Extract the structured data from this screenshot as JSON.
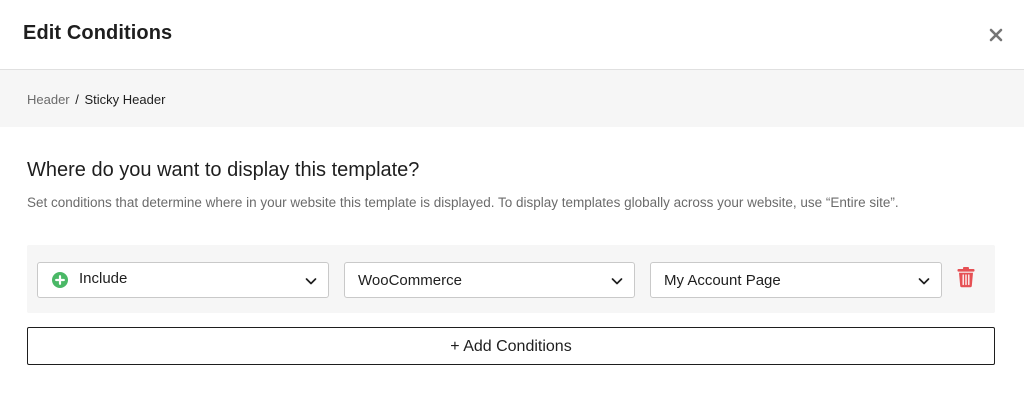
{
  "modal": {
    "title": "Edit Conditions"
  },
  "breadcrumb": {
    "parent": "Header",
    "separator": "/",
    "current": "Sticky Header"
  },
  "section": {
    "title": "Where do you want to display this template?",
    "description": "Set conditions that determine where in your website this template is displayed. To display templates globally across your website, use “Entire site”."
  },
  "condition": {
    "type": "Include",
    "group": "WooCommerce",
    "page": "My Account Page"
  },
  "add_button": {
    "label": "+ Add Conditions"
  },
  "colors": {
    "include_icon": "#4ab866",
    "trash_icon": "#e65054",
    "panel_bg": "#f6f6f6"
  },
  "icons": {
    "close": "close-icon",
    "include": "plus-circle-icon",
    "dropdown": "chevron-down-icon",
    "delete": "trash-icon"
  }
}
